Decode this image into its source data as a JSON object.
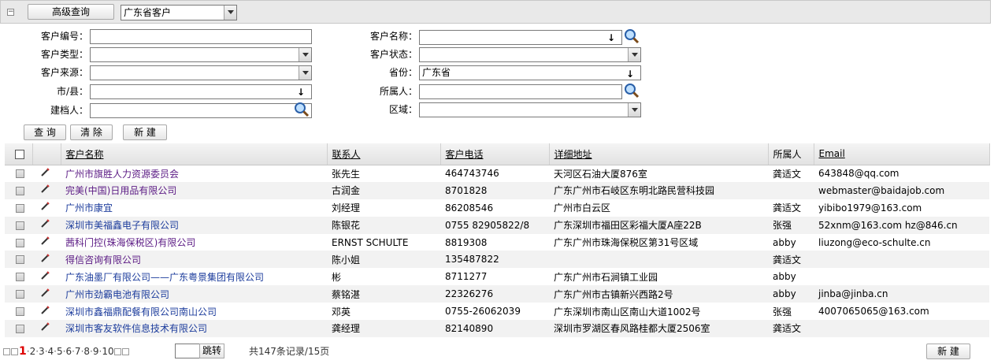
{
  "toolbar": {
    "advanced_search": "高级查询",
    "filter_select": "广东省客户"
  },
  "form": {
    "customer_no_label": "客户编号：",
    "customer_type_label": "客户类型：",
    "customer_source_label": "客户来源：",
    "city_label": "市/县：",
    "creator_label": "建档人：",
    "customer_name_label": "客户名称：",
    "customer_status_label": "客户状态：",
    "province_label": "省份：",
    "province_value": "广东省",
    "owner_label": "所属人：",
    "region_label": "区域：",
    "query_button": "查 询",
    "clear_button": "清 除",
    "new_button": "新 建"
  },
  "table": {
    "headers": {
      "name": "客户名称",
      "contact": "联系人",
      "phone": "客户电话",
      "address": "详细地址",
      "owner": "所属人",
      "email": "Email"
    },
    "rows": [
      {
        "name": "广州市旗胜人力资源委员会",
        "contact": "张先生",
        "phone": "464743746",
        "address": "天河区石油大厦876室",
        "owner": "龚适文",
        "email": "643848@qq.com"
      },
      {
        "name": "完美(中国)日用品有限公司",
        "contact": "古润金",
        "phone": "8701828",
        "address": "广东广州市石岐区东明北路民营科技园",
        "owner": "",
        "email": "webmaster@baidajob.com"
      },
      {
        "name": "广州市康宜",
        "contact": "刘经理",
        "phone": "86208546",
        "address": "广州市白云区",
        "owner": "龚适文",
        "email": "yibibo1979@163.com"
      },
      {
        "name": "深圳市美福鑫电子有限公司",
        "contact": "陈银花",
        "phone": "0755 82905822/8",
        "address": "广东深圳市福田区彩福大厦A座22B",
        "owner": "张强",
        "email": "52xnm@163.com hz@846.cn"
      },
      {
        "name": "茜科门控(珠海保税区)有限公司",
        "contact": "ERNST SCHULTE",
        "phone": "8819308",
        "address": "广东广州市珠海保税区第31号区域",
        "owner": "abby",
        "email": "liuzong@eco-schulte.cn"
      },
      {
        "name": "得信咨询有限公司",
        "contact": "陈小姐",
        "phone": "135487822",
        "address": "",
        "owner": "龚适文",
        "email": ""
      },
      {
        "name": "广东油墨厂有限公司——广东粤景集团有限公司",
        "contact": "彬",
        "phone": "8711277",
        "address": "广东广州市石涧镇工业园",
        "owner": "abby",
        "email": ""
      },
      {
        "name": "广州市劲霸电池有限公司",
        "contact": "蔡铭湛",
        "phone": "22326276",
        "address": "广东广州市古镇新兴西路2号",
        "owner": "abby",
        "email": "jinba@jinba.cn"
      },
      {
        "name": "深圳市鑫福鼎配餐有限公司南山公司",
        "contact": "邓英",
        "phone": "0755-26062039",
        "address": "广东深圳市南山区南山大道1002号",
        "owner": "张强",
        "email": "4007065065@163.com"
      },
      {
        "name": "深圳市客友软件信息技术有限公司",
        "contact": "龚经理",
        "phone": "82140890",
        "address": "深圳市罗湖区春风路桂都大厦2506室",
        "owner": "龚适文",
        "email": ""
      }
    ]
  },
  "pager": {
    "pages": [
      "1",
      "2",
      "3",
      "4",
      "5",
      "6",
      "7",
      "8",
      "9",
      "10"
    ],
    "jump_button": "跳转",
    "summary": "共147条记录/15页",
    "new_button": "新 建"
  },
  "colors": {
    "link_purple": "#5b1a84",
    "link_blue": "#1c3c9c",
    "current_page": "#dd0000"
  }
}
